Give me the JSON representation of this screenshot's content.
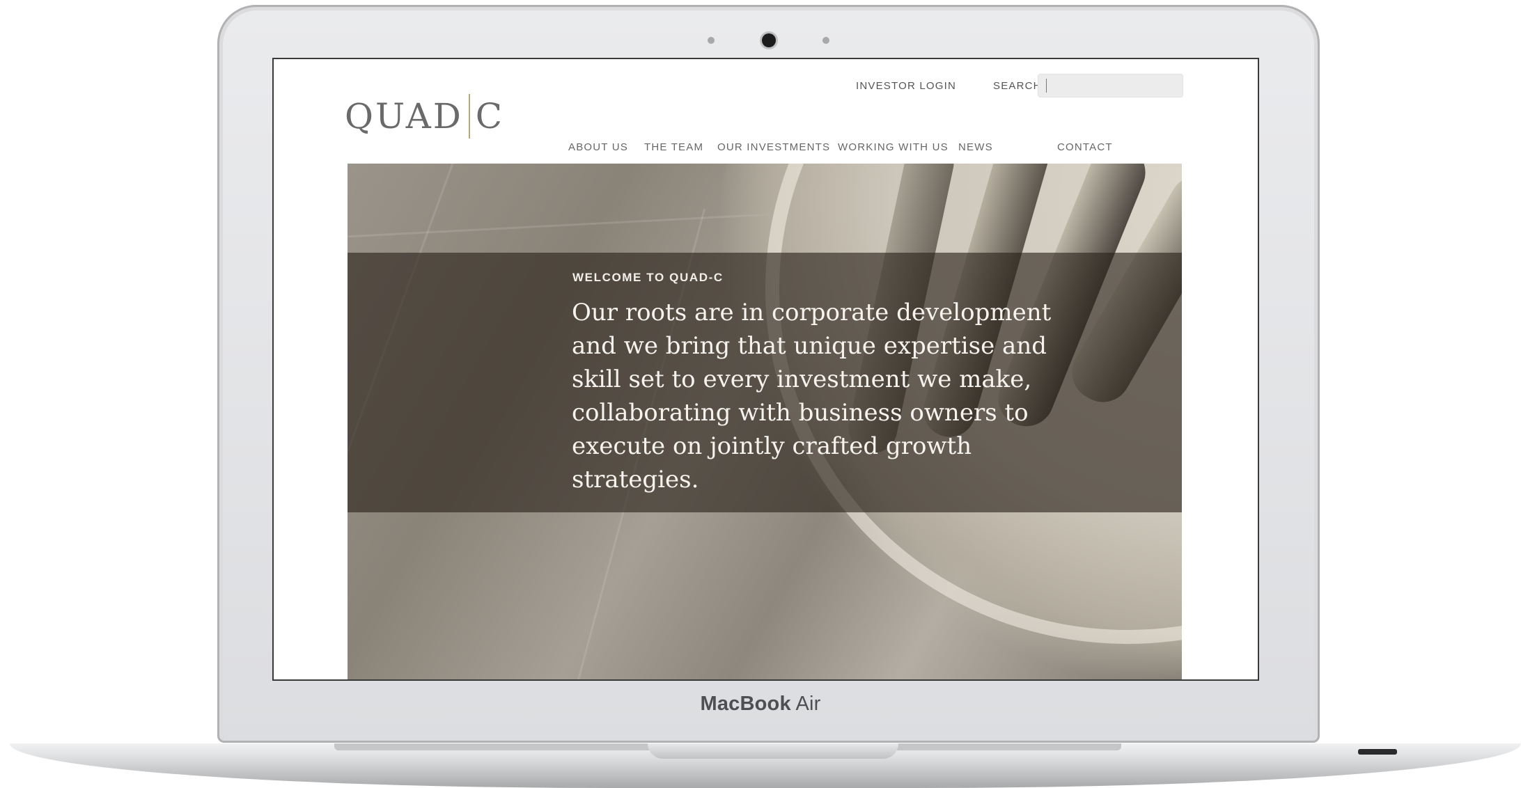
{
  "device": {
    "model_brand": "MacBook",
    "model_name": "Air"
  },
  "site": {
    "logo": {
      "left": "QUAD",
      "right": "C"
    },
    "utility": {
      "investor_login": "INVESTOR LOGIN",
      "search_label": "SEARCH",
      "search_value": ""
    },
    "nav": [
      {
        "label": "ABOUT US"
      },
      {
        "label": "THE TEAM"
      },
      {
        "label": "OUR INVESTMENTS"
      },
      {
        "label": "WORKING WITH US"
      },
      {
        "label": "NEWS"
      },
      {
        "label": "CONTACT"
      }
    ],
    "hero": {
      "eyebrow": "WELCOME TO QUAD-C",
      "headline": "Our roots are in corporate development and we bring that unique expertise and skill set to every investment we make, collaborating with business owners to execute on jointly crafted growth strategies."
    }
  },
  "colors": {
    "logo_divider": "#bba76f",
    "hero_band": "#2a221a",
    "text_muted": "#666666"
  }
}
